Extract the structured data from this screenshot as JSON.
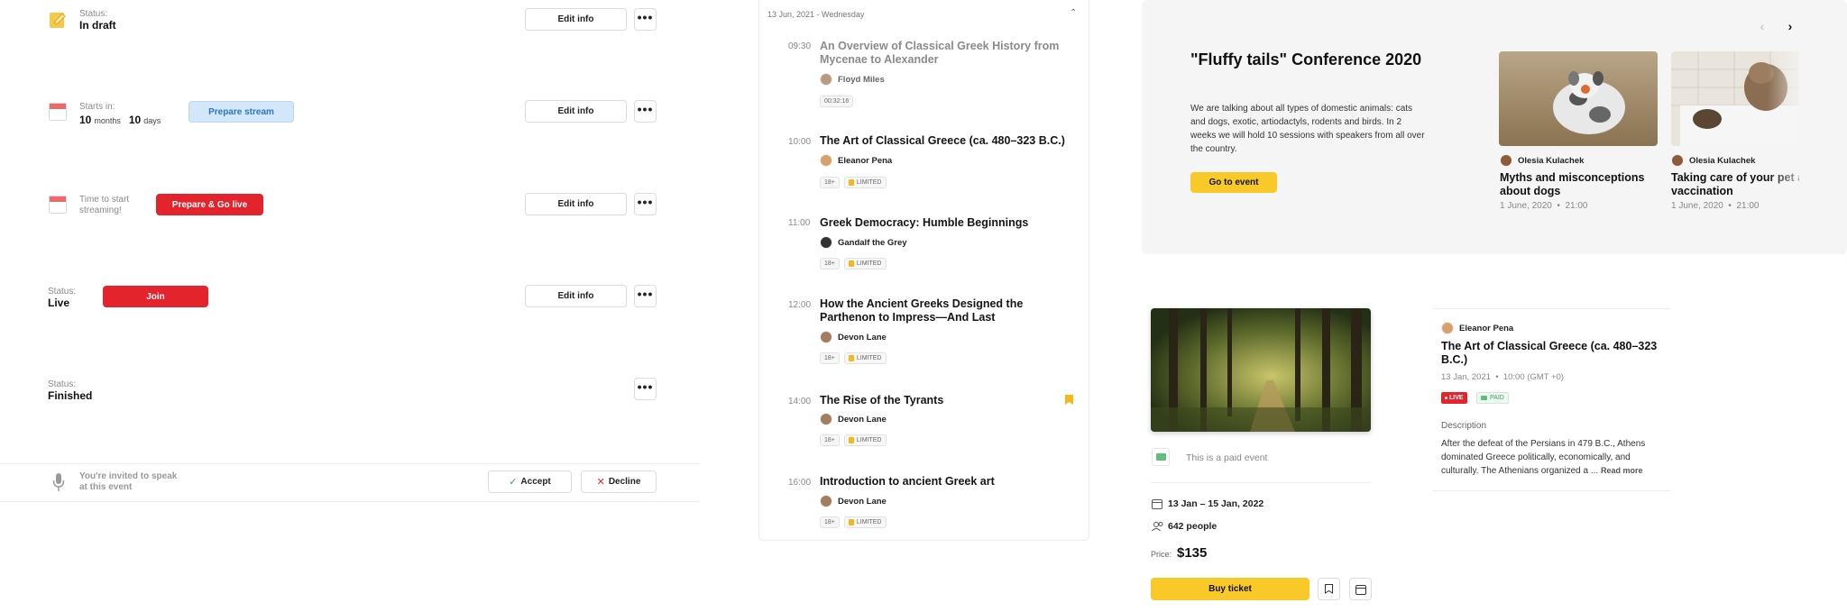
{
  "status_rows": [
    {
      "label": "Status:",
      "value": "In draft",
      "edit": "Edit info",
      "more": "•••"
    },
    {
      "label": "Starts in:",
      "n1": "10",
      "u1": "months",
      "n2": "10",
      "u2": "days",
      "action": "Prepare stream",
      "edit": "Edit info",
      "more": "•••"
    },
    {
      "label": "Time to start streaming!",
      "action": "Prepare & Go live",
      "edit": "Edit info",
      "more": "•••"
    },
    {
      "label": "Status:",
      "value": "Live",
      "action": "Join",
      "edit": "Edit info",
      "more": "•••"
    },
    {
      "label": "Status:",
      "value": "Finished",
      "more": "•••"
    }
  ],
  "invite": {
    "text": "You're invited to speak at this event",
    "accept": "Accept",
    "decline": "Decline"
  },
  "schedule": {
    "date": "13 Jun, 2021 - Wednesday",
    "sessions": [
      {
        "time": "09:30",
        "title": "An Overview of Classical Greek History from Mycenae to Alexander",
        "speaker": "Floyd Miles",
        "duration": "00:32:16"
      },
      {
        "time": "10:00",
        "title": "The Art of Classical Greece (ca. 480–323 B.C.)",
        "speaker": "Eleanor Pena",
        "age": "18+",
        "access": "LIMITED"
      },
      {
        "time": "11:00",
        "title": "Greek Democracy: Humble Beginnings",
        "speaker": "Gandalf the Grey",
        "age": "18+",
        "access": "LIMITED"
      },
      {
        "time": "12:00",
        "title": "How the Ancient Greeks Designed the Parthenon to Impress—And Last",
        "speaker": "Devon Lane",
        "age": "18+",
        "access": "LIMITED"
      },
      {
        "time": "14:00",
        "title": "The Rise of the Tyrants",
        "speaker": "Devon Lane",
        "age": "18+",
        "access": "LIMITED"
      },
      {
        "time": "16:00",
        "title": "Introduction to ancient Greek art",
        "speaker": "Devon Lane",
        "age": "18+",
        "access": "LIMITED"
      }
    ]
  },
  "conference": {
    "title": "\"Fluffy tails\" Conference 2020",
    "description": "We are talking about all types of domestic animals: cats and dogs, exotic, artiodactyls, rodents and birds. In 2 weeks we will hold 10 sessions with speakers from all over the country.",
    "cta": "Go to event",
    "cards": [
      {
        "author": "Olesia Kulachek",
        "title_1": "Myths and misconceptions",
        "title_2": "about dogs",
        "date": "1 June, 2020",
        "time": "21:00"
      },
      {
        "author": "Olesia Kulachek",
        "title_1": "Taking care of your pet a",
        "title_2": "vaccination",
        "date": "1 June, 2020",
        "time": "21:00"
      }
    ]
  },
  "event": {
    "paid_text": "This is a paid event",
    "dates": "13  Jan – 15  Jan, 2022",
    "people": "642 people",
    "price_label": "Price:",
    "price": "$135",
    "buy": "Buy ticket"
  },
  "detail": {
    "author": "Eleanor Pena",
    "title": "The Art of Classical Greece (ca. 480–323 B.C.)",
    "date": "13  Jan, 2021",
    "time": "10:00 (GMT +0)",
    "live": "LIVE",
    "paid": "PAID",
    "desc_heading": "Description",
    "desc": "After the defeat of the Persians in 479 B.C., Athens dominated Greece politically, economically, and culturally. The Athenians organized a ...",
    "read_more": "Read more"
  },
  "colors": {
    "red": "#e4242d",
    "yellow": "#f8c928",
    "blue_light": "#d3e7fb",
    "bookmark": "#f5b81c"
  }
}
